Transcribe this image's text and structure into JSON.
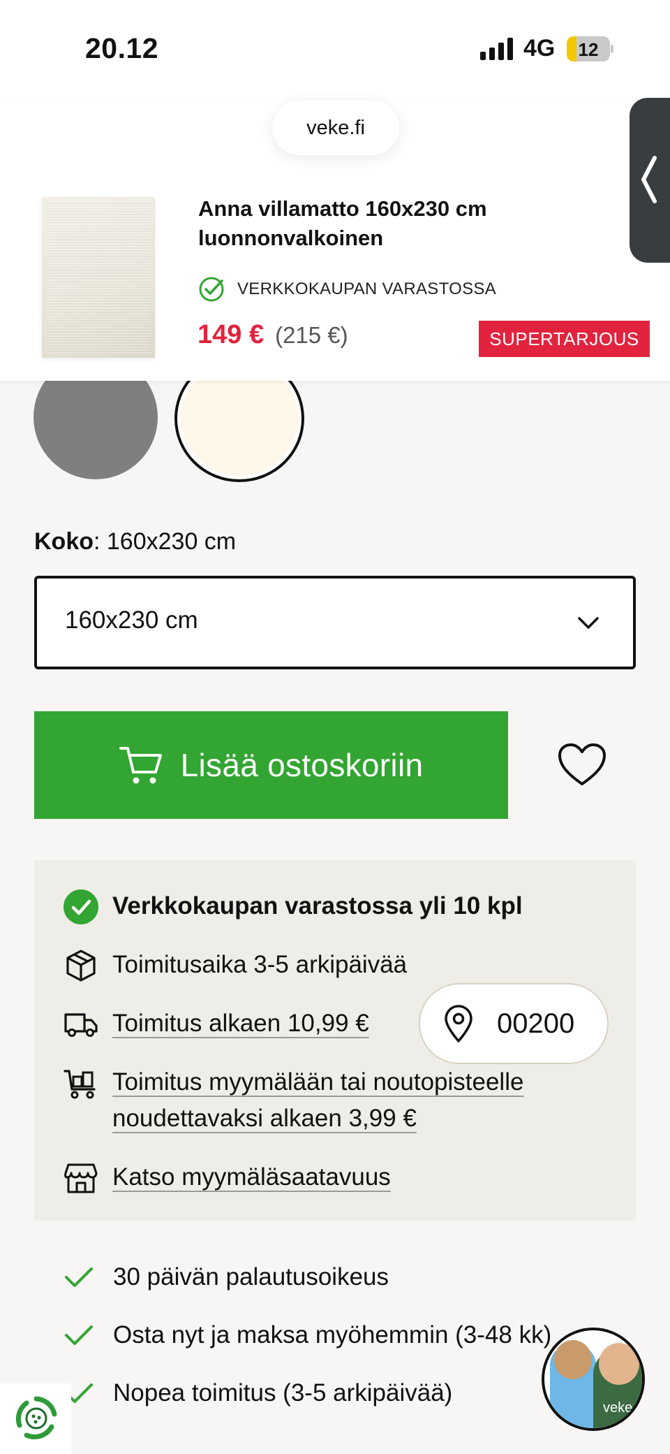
{
  "status_bar": {
    "time": "20.12",
    "network": "4G",
    "battery": "12"
  },
  "browser": {
    "url": "veke.fi"
  },
  "sticky_header": {
    "product_title": "Anna villamatto 160x230 cm luonnonvalkoinen",
    "stock_text": "VERKKOKAUPAN VARASTOSSA",
    "price": "149 €",
    "original_price": "(215 €)",
    "badge": "SUPERTARJOUS"
  },
  "swatches": [
    {
      "color": "#7f7f7f",
      "selected": false
    },
    {
      "color": "#fff8ea",
      "selected": true
    }
  ],
  "size": {
    "label_key": "Koko",
    "label_value": ": 160x230 cm",
    "selected_option": "160x230 cm"
  },
  "actions": {
    "add_to_cart": "Lisää ostoskoriin"
  },
  "availability": {
    "stock": "Verkkokaupan varastossa yli 10 kpl",
    "delivery_time": "Toimitus­aika 3-5 arkipäivää",
    "delivery_price": "Toimitus alkaen 10,99 €",
    "pickup_line1": "Toimitus myymälään tai noutopisteelle",
    "pickup_line2": "noudettavaksi alkaen 3,99 €",
    "store_availability": "Katso myymäläsaatavuus",
    "postal_code": "00200"
  },
  "benefits": [
    "30 päivän palautusoikeus",
    "Osta nyt ja maksa myöhemmin (3-48 kk)",
    "Nopea toimitus (3-5 arkipäivää)"
  ],
  "chat": {
    "brand": "veke"
  },
  "colors": {
    "accent_green": "#32a532",
    "sale_red": "#e2233e",
    "info_bg": "#efede7"
  }
}
